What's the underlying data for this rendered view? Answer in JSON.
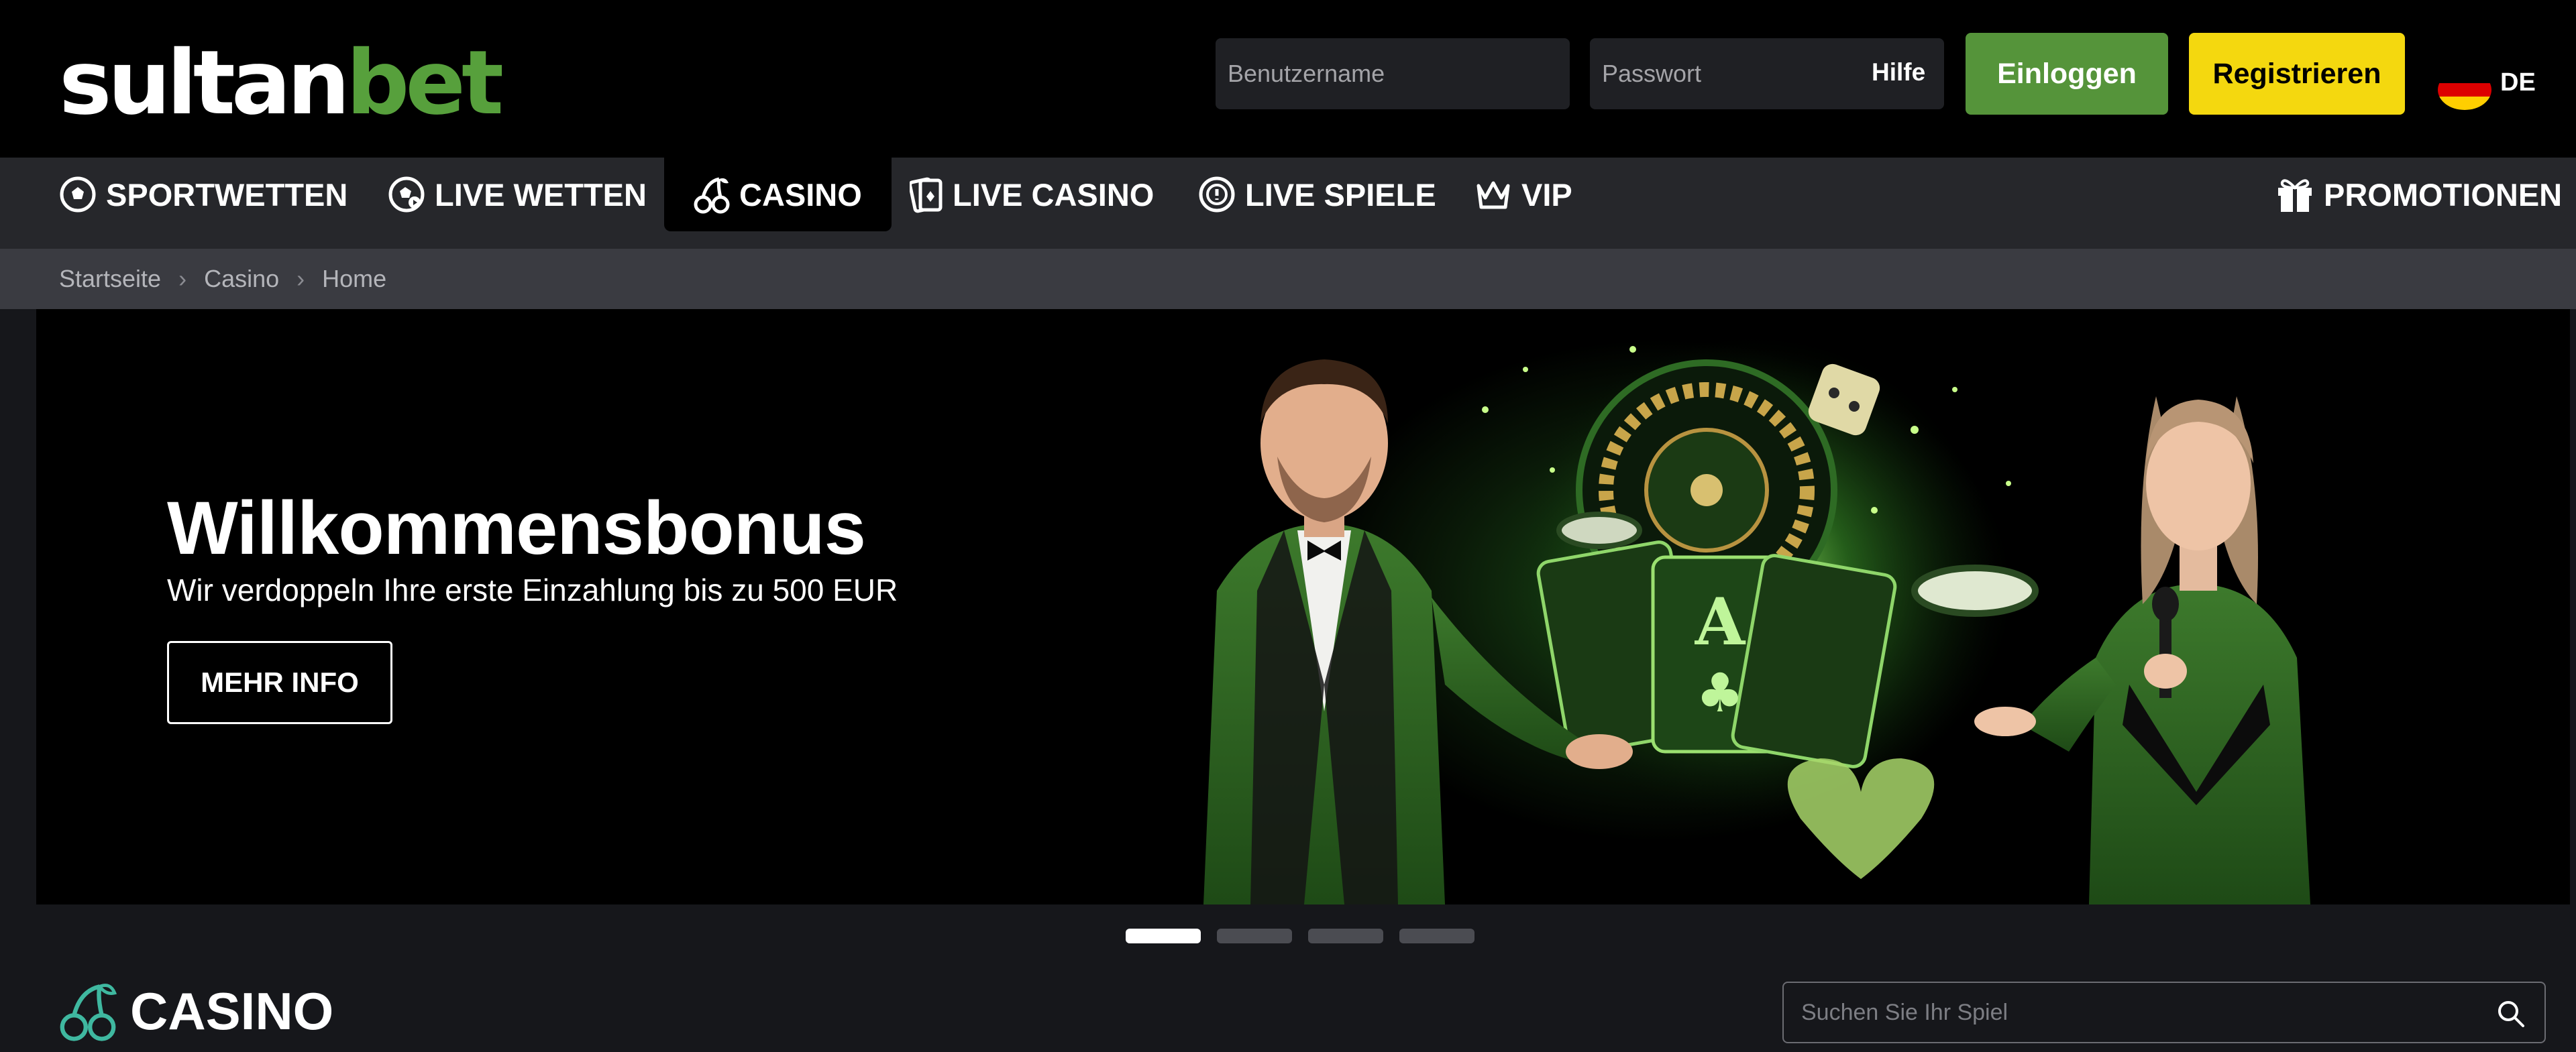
{
  "header": {
    "logo": {
      "part1": "sultan",
      "part2": "bet"
    },
    "username_placeholder": "Benutzername",
    "password_placeholder": "Passwort",
    "help_label": "Hilfe",
    "login_label": "Einloggen",
    "register_label": "Registrieren",
    "language": "DE",
    "flag_icon": "germany-flag-icon"
  },
  "nav": {
    "items": [
      {
        "label": "SPORTWETTEN",
        "icon": "soccer-ball-icon"
      },
      {
        "label": "LIVE WETTEN",
        "icon": "live-ball-icon"
      },
      {
        "label": "CASINO",
        "icon": "cherry-icon",
        "active": true
      },
      {
        "label": "LIVE CASINO",
        "icon": "cards-icon"
      },
      {
        "label": "LIVE SPIELE",
        "icon": "live-games-icon"
      },
      {
        "label": "VIP",
        "icon": "crown-icon"
      }
    ],
    "promotions": {
      "label": "PROMOTIONEN",
      "icon": "gift-icon"
    }
  },
  "breadcrumb": [
    "Startseite",
    "Casino",
    "Home"
  ],
  "banner": {
    "title": "Willkommensbonus",
    "subtitle": "Wir verdoppeln Ihre erste Einzahlung bis zu 500 EUR",
    "button_label": "MEHR INFO",
    "slides": 4,
    "active_slide": 1
  },
  "casino": {
    "title": "CASINO",
    "icon": "cherry-icon",
    "search_placeholder": "Suchen Sie Ihr Spiel",
    "search_icon": "search-icon"
  },
  "colors": {
    "accent_green": "#57a03c",
    "login_button": "#55943a",
    "register_button": "#f4d80f",
    "header_bg": "#000000",
    "nav_bg": "#26272b",
    "breadcrumb_bg": "#3a3b41",
    "page_bg": "#16171b"
  }
}
